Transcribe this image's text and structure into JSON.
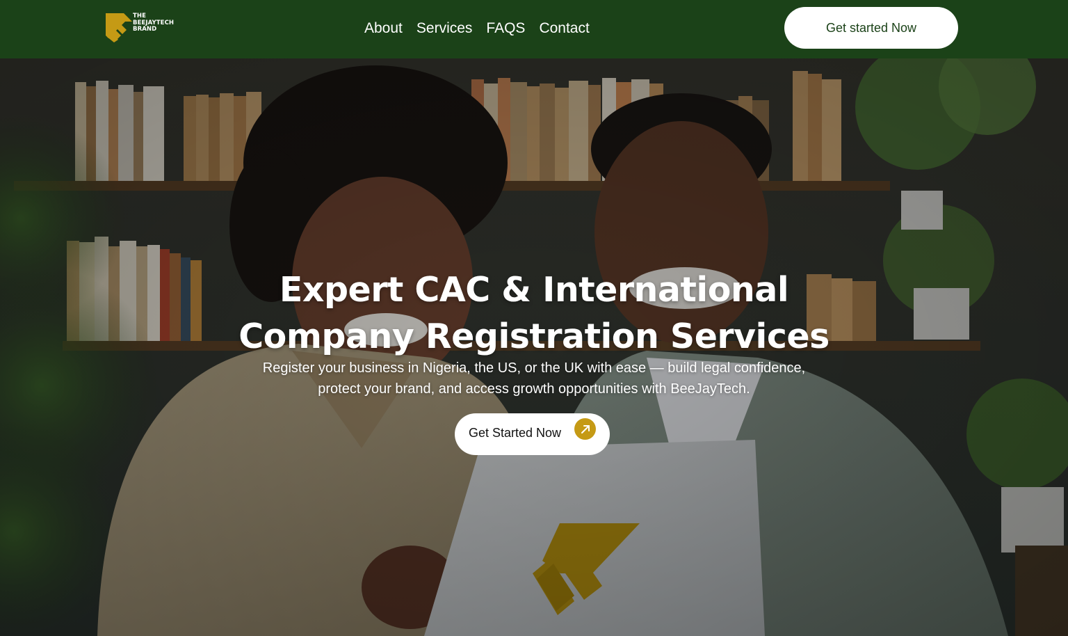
{
  "header": {
    "logo_lines": [
      "THE",
      "BEEJAYTECH",
      "BRAND"
    ],
    "nav": [
      {
        "label": "About"
      },
      {
        "label": "Services"
      },
      {
        "label": "FAQS"
      },
      {
        "label": "Contact"
      }
    ],
    "cta_label": "Get started Now"
  },
  "hero": {
    "title_lines": [
      "Expert CAC & International",
      "Company Registration Services"
    ],
    "subtitle_lines": [
      "Register your business in Nigeria, the US, or the UK with ease — build legal confidence,",
      "protect your brand, and access growth opportunities with BeeJayTech."
    ],
    "cta_label": "Get Started Now",
    "cta_icon": "arrow-up-right-icon"
  },
  "colors": {
    "header_bg": "#1b4218",
    "brand_gold": "#c59a15",
    "button_bg": "#ffffff",
    "text_light": "#ffffff"
  }
}
